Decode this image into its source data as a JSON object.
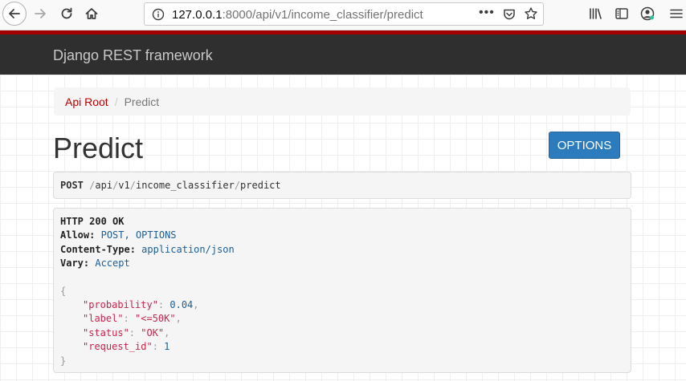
{
  "browser": {
    "url_host": "127.0.0.1",
    "url_rest": ":8000/api/v1/income_classifier/predict",
    "page_actions": "•••"
  },
  "drf": {
    "brand": "Django REST framework",
    "breadcrumb": [
      {
        "label": "Api Root"
      },
      {
        "label": "Predict"
      }
    ],
    "breadcrumb_sep": "/",
    "page_title": "Predict",
    "options_button": "OPTIONS",
    "request": {
      "method": "POST",
      "path_parts": [
        "/",
        "api",
        "/",
        "v1",
        "/",
        "income_classifier",
        "/",
        "predict"
      ]
    },
    "response": {
      "status_line": "HTTP 200 OK",
      "headers": [
        {
          "name": "Allow:",
          "value": "POST, OPTIONS"
        },
        {
          "name": "Content-Type:",
          "value": "application/json"
        },
        {
          "name": "Vary:",
          "value": "Accept"
        }
      ],
      "json_open": "{",
      "json_close": "}",
      "fields": [
        {
          "key": "\"probability\"",
          "value": "0.04",
          "kind": "num",
          "comma": ","
        },
        {
          "key": "\"label\"",
          "value": "\"<=50K\"",
          "kind": "str",
          "comma": ","
        },
        {
          "key": "\"status\"",
          "value": "\"OK\"",
          "kind": "str",
          "comma": ","
        },
        {
          "key": "\"request_id\"",
          "value": "1",
          "kind": "num",
          "comma": ""
        }
      ]
    }
  }
}
